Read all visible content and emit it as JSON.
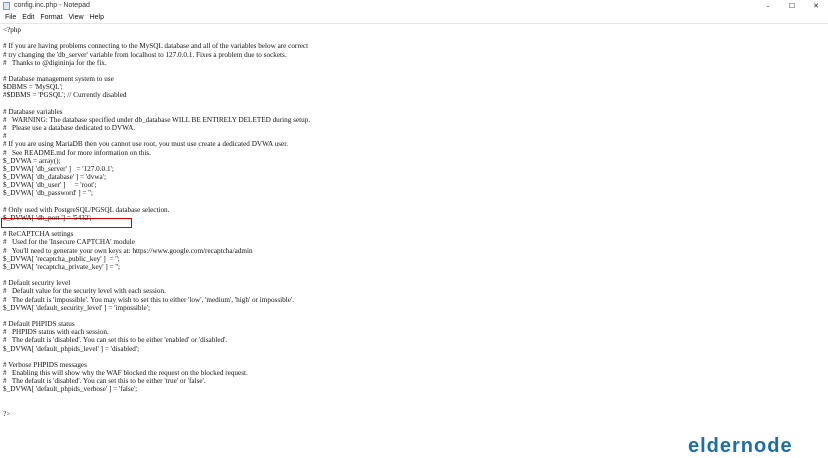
{
  "window": {
    "title": "config.inc.php - Notepad",
    "app_icon": "notepad-icon",
    "controls": {
      "minimize": "–",
      "maximize": "☐",
      "close": "✕"
    }
  },
  "menu": [
    "File",
    "Edit",
    "Format",
    "View",
    "Help"
  ],
  "editor": {
    "lines": [
      "<?php",
      "",
      "# If you are having problems connecting to the MySQL database and all of the variables below are correct",
      "# try changing the 'db_server' variable from localhost to 127.0.0.1. Fixes a problem due to sockets.",
      "#   Thanks to @digininja for the fix.",
      "",
      "# Database management system to use",
      "$DBMS = 'MySQL';",
      "#$DBMS = 'PGSQL'; // Currently disabled",
      "",
      "# Database variables",
      "#   WARNING: The database specified under db_database WILL BE ENTIRELY DELETED during setup.",
      "#   Please use a database dedicated to DVWA.",
      "#",
      "# If you are using MariaDB then you cannot use root, you must use create a dedicated DVWA user.",
      "#   See README.md for more information on this.",
      "$_DVWA = array();",
      "$_DVWA[ 'db_server' ]   = '127.0.0.1';",
      "$_DVWA[ 'db_database' ] = 'dvwa';",
      "$_DVWA[ 'db_user' ]     = 'root';",
      "$_DVWA[ 'db_password' ] = '';",
      "",
      "# Only used with PostgreSQL/PGSQL database selection.",
      "$_DVWA[ 'db_port '] = '5432';",
      "",
      "# ReCAPTCHA settings",
      "#   Used for the 'Insecure CAPTCHA' module",
      "#   You'll need to generate your own keys at: https://www.google.com/recaptcha/admin",
      "$_DVWA[ 'recaptcha_public_key' ]  = '';",
      "$_DVWA[ 'recaptcha_private_key' ] = '';",
      "",
      "# Default security level",
      "#   Default value for the security level with each session.",
      "#   The default is 'impossible'. You may wish to set this to either 'low', 'medium', 'high' or impossible'.",
      "$_DVWA[ 'default_security_level' ] = 'impossible';",
      "",
      "# Default PHPIDS status",
      "#   PHPIDS status with each session.",
      "#   The default is 'disabled'. You can set this to be either 'enabled' or 'disabled'.",
      "$_DVWA[ 'default_phpids_level' ] = 'disabled';",
      "",
      "# Verbose PHPIDS messages",
      "#   Enabling this will show why the WAF blocked the request on the blocked request.",
      "#   The default is 'disabled'. You can set this to be either 'true' or 'false'.",
      "$_DVWA[ 'default_phpids_verbose' ] = 'false';",
      "",
      "",
      "?>"
    ]
  },
  "watermark": {
    "text": "eldernode",
    "color": "#1a6fa8"
  }
}
